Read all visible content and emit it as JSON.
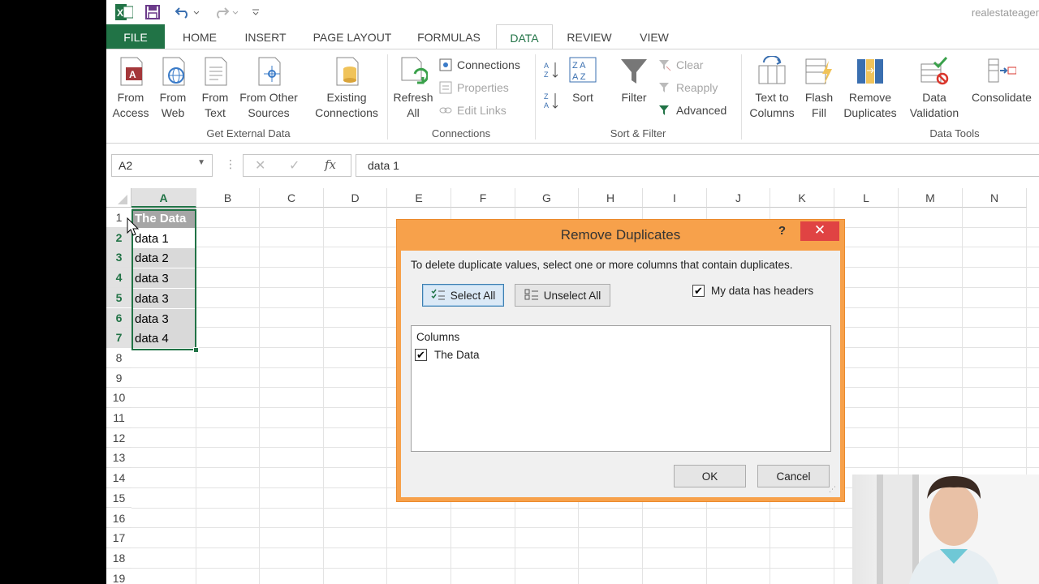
{
  "qat": {
    "watermark": "realestateager"
  },
  "tabs": [
    {
      "label": "FILE"
    },
    {
      "label": "HOME"
    },
    {
      "label": "INSERT"
    },
    {
      "label": "PAGE LAYOUT"
    },
    {
      "label": "FORMULAS"
    },
    {
      "label": "DATA"
    },
    {
      "label": "REVIEW"
    },
    {
      "label": "VIEW"
    }
  ],
  "ribbon": {
    "from_access": "From\nAccess",
    "from_web": "From\nWeb",
    "from_text": "From\nText",
    "from_other": "From Other\nSources",
    "existing": "Existing\nConnections",
    "get_external": "Get External Data",
    "refresh": "Refresh\nAll",
    "connections_small": "Connections",
    "properties_small": "Properties",
    "edit_links_small": "Edit Links",
    "connections_group": "Connections",
    "sort": "Sort",
    "filter": "Filter",
    "clear": "Clear",
    "reapply": "Reapply",
    "advanced": "Advanced",
    "sort_filter_group": "Sort & Filter",
    "text_to_columns": "Text to\nColumns",
    "flash_fill": "Flash\nFill",
    "remove_duplicates": "Remove\nDuplicates",
    "data_validation": "Data\nValidation",
    "consolidate": "Consolidate",
    "data_tools_group": "Data Tools"
  },
  "formula_bar": {
    "name_box": "A2",
    "formula": "data 1"
  },
  "grid": {
    "columns": [
      "A",
      "B",
      "C",
      "D",
      "E",
      "F",
      "G",
      "H",
      "I",
      "J",
      "K",
      "L",
      "M",
      "N"
    ],
    "rows": [
      "1",
      "2",
      "3",
      "4",
      "5",
      "6",
      "7",
      "8",
      "9",
      "10",
      "11",
      "12",
      "13",
      "14",
      "15",
      "16",
      "17",
      "18",
      "19"
    ],
    "cells": [
      "The Data",
      "data 1",
      "data 2",
      "data 3",
      "data 3",
      "data 3",
      "data 4"
    ]
  },
  "dialog": {
    "title": "Remove Duplicates",
    "help": "?",
    "close": "✕",
    "instruction": "To delete duplicate values, select one or more columns that contain duplicates.",
    "select_all": "Select All",
    "unselect_all": "Unselect All",
    "headers_label": "My data has headers",
    "columns_header": "Columns",
    "column_item": "The Data",
    "ok": "OK",
    "cancel": "Cancel"
  },
  "colors": {
    "excel_green": "#217346",
    "dialog_accent": "#f7a14b",
    "close_red": "#e04343"
  }
}
